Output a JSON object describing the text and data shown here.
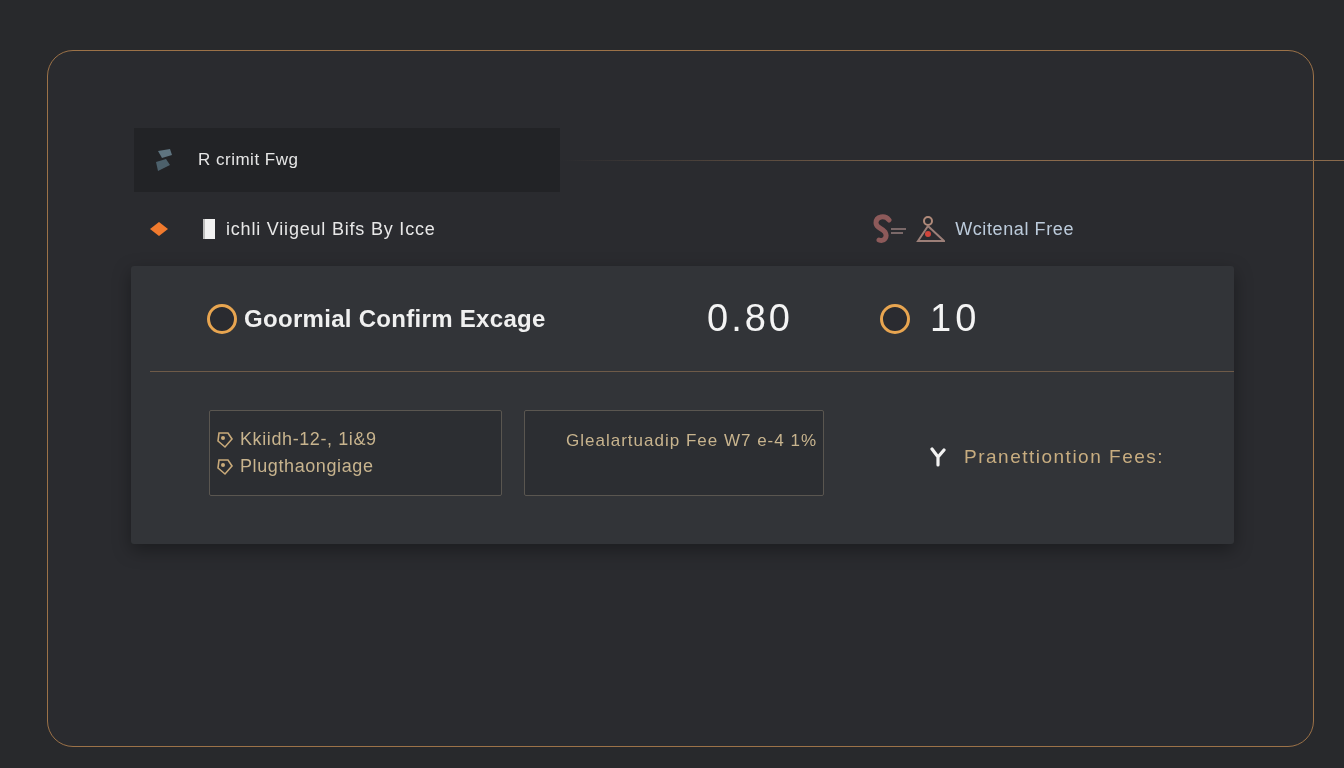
{
  "header": {
    "title": "R crimit Fwg"
  },
  "subheader": {
    "title": "ichli Viigeul Bifs By Icce",
    "right_label": "Wcitenal Free"
  },
  "summary": {
    "title": "Goormial Confirm Excage",
    "value": "0.80",
    "count": "10"
  },
  "cards": [
    {
      "kind": "list",
      "items": [
        {
          "text": "Kkiidh-12-, 1i&9"
        },
        {
          "text": "Plugthaongiage"
        }
      ]
    },
    {
      "kind": "text",
      "text": "Glealartuadip Fee W7 e-4 1%"
    }
  ],
  "fees": {
    "label": "Pranettiontion Fees:"
  }
}
